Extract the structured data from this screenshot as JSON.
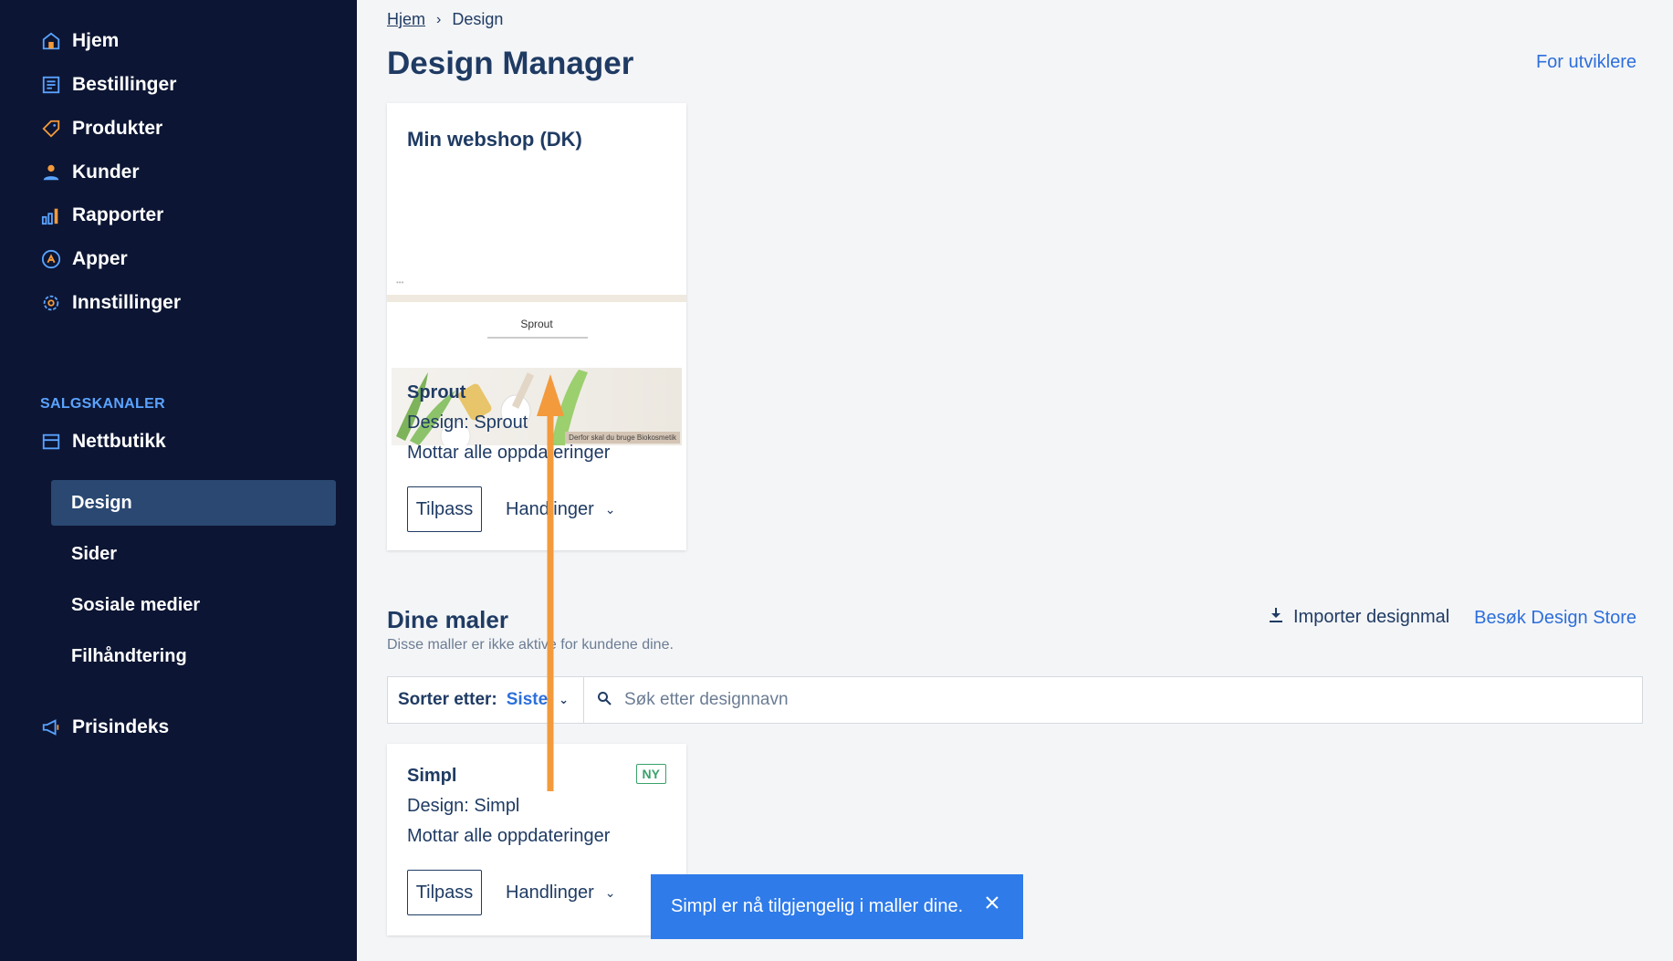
{
  "sidebar": {
    "items": [
      {
        "label": "Hjem",
        "icon": "home-icon"
      },
      {
        "label": "Bestillinger",
        "icon": "orders-icon"
      },
      {
        "label": "Produkter",
        "icon": "tag-icon"
      },
      {
        "label": "Kunder",
        "icon": "user-icon"
      },
      {
        "label": "Rapporter",
        "icon": "bar-chart-icon"
      },
      {
        "label": "Apper",
        "icon": "apps-icon"
      },
      {
        "label": "Innstillinger",
        "icon": "gear-icon"
      }
    ],
    "section_label": "SALGSKANALER",
    "channel": {
      "label": "Nettbutikk",
      "icon": "store-icon"
    },
    "sub_items": [
      {
        "label": "Design",
        "active": true
      },
      {
        "label": "Sider"
      },
      {
        "label": "Sosiale medier"
      },
      {
        "label": "Filhåndtering"
      }
    ],
    "price_index": {
      "label": "Prisindeks",
      "icon": "megaphone-icon"
    }
  },
  "breadcrumb": {
    "home": "Hjem",
    "current": "Design"
  },
  "page_title": "Design Manager",
  "dev_link": "For utviklere",
  "active_shop": {
    "name": "Min webshop (DK)",
    "preview_logo": "Sprout",
    "preview_banner": "Derfor skal du bruge Biokosmetik",
    "theme_name": "Sprout",
    "design_line": "Design: Sprout",
    "update_line": "Mottar alle oppdateringer",
    "customize_label": "Tilpass",
    "actions_label": "Handlinger"
  },
  "templates": {
    "title": "Dine maler",
    "subtitle": "Disse maller er ikke aktive for kundene dine.",
    "import_label": "Importer designmal",
    "store_link": "Besøk Design Store",
    "sort_label": "Sorter etter:",
    "sort_value": "Siste",
    "search_placeholder": "Søk etter designnavn",
    "items": [
      {
        "name": "Simpl",
        "badge": "NY",
        "design_line": "Design: Simpl",
        "update_line": "Mottar alle oppdateringer",
        "customize_label": "Tilpass",
        "actions_label": "Handlinger"
      }
    ]
  },
  "toast": {
    "message": "Simpl er nå tilgjengelig i maller dine."
  },
  "colors": {
    "sidebar_bg": "#0c1533",
    "active_bg": "#2a4872",
    "link": "#2d6fdb",
    "toast_bg": "#2f7bea",
    "badge": "#3aa26a",
    "annotation_arrow": "#f39a3c"
  }
}
